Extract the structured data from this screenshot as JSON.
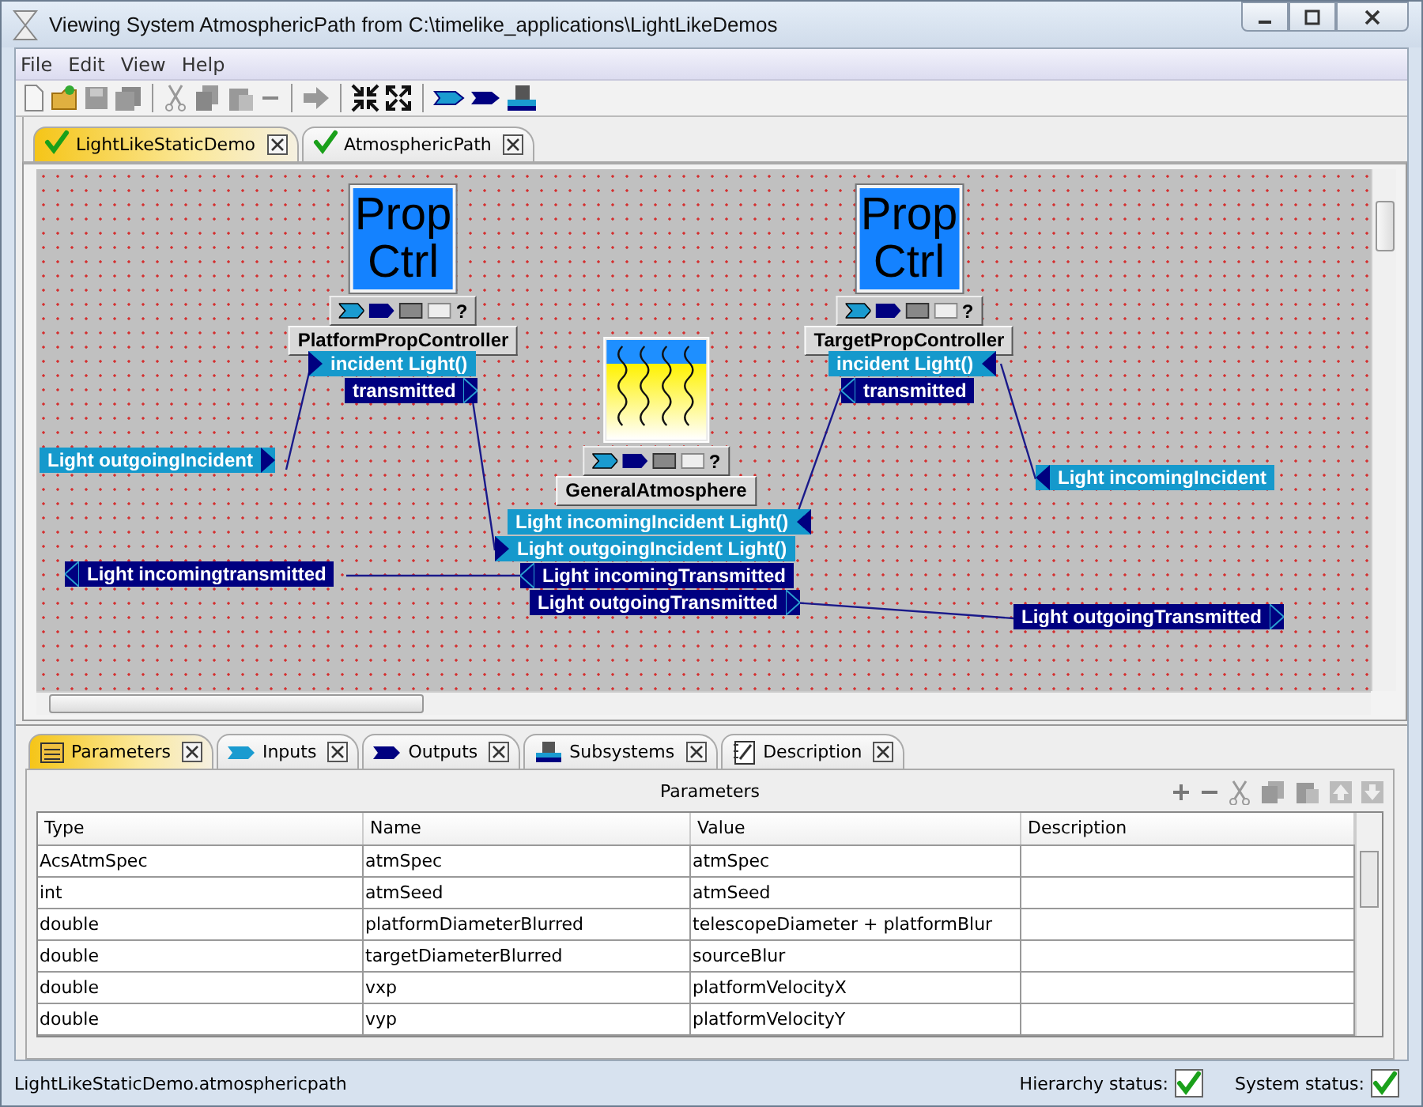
{
  "window": {
    "title": "Viewing System AtmosphericPath from C:\\timelike_applications\\LightLikeDemos"
  },
  "menu": [
    "File",
    "Edit",
    "View",
    "Help"
  ],
  "tabs": [
    {
      "label": "LightLikeStaticDemo",
      "selected": true,
      "valid": true
    },
    {
      "label": "AtmosphericPath",
      "selected": false,
      "valid": true
    }
  ],
  "diagram": {
    "nodes": [
      {
        "kind": "prop-ctrl",
        "icon_lines": [
          "Prop",
          "Ctrl"
        ],
        "help": "?",
        "name": "PlatformPropController",
        "ports": [
          {
            "label": "incident Light()",
            "kind": "input"
          },
          {
            "label": "transmitted",
            "kind": "output"
          }
        ]
      },
      {
        "kind": "prop-ctrl",
        "icon_lines": [
          "Prop",
          "Ctrl"
        ],
        "help": "?",
        "name": "TargetPropController",
        "ports": [
          {
            "label": "incident Light()",
            "kind": "input"
          },
          {
            "label": "transmitted",
            "kind": "output"
          }
        ]
      },
      {
        "kind": "atmosphere",
        "help": "?",
        "name": "GeneralAtmosphere",
        "ports": [
          {
            "label": "Light incomingIncident Light()",
            "kind": "input"
          },
          {
            "label": "Light outgoingIncident  Light()",
            "kind": "input"
          },
          {
            "label": "Light incomingTransmitted",
            "kind": "output"
          },
          {
            "label": "Light outgoingTransmitted",
            "kind": "output"
          }
        ]
      }
    ],
    "boundary_ports": [
      {
        "label": "Light outgoingIncident",
        "kind": "input"
      },
      {
        "label": "Light incomingIncident",
        "kind": "input"
      },
      {
        "label": "Light incomingtransmitted",
        "kind": "output"
      },
      {
        "label": "Light outgoingTransmitted",
        "kind": "output"
      }
    ]
  },
  "panel_tabs": [
    {
      "label": "Parameters",
      "kind": "parameters",
      "selected": true
    },
    {
      "label": "Inputs",
      "kind": "inputs",
      "selected": false
    },
    {
      "label": "Outputs",
      "kind": "outputs",
      "selected": false
    },
    {
      "label": "Subsystems",
      "kind": "subsystems",
      "selected": false
    },
    {
      "label": "Description",
      "kind": "description",
      "selected": false
    }
  ],
  "parameters": {
    "title": "Parameters",
    "columns": [
      "Type",
      "Name",
      "Value",
      "Description"
    ],
    "rows": [
      {
        "type": "AcsAtmSpec",
        "name": "atmSpec",
        "value": "atmSpec"
      },
      {
        "type": "int",
        "name": "atmSeed",
        "value": "atmSeed"
      },
      {
        "type": "double",
        "name": "platformDiameterBlurred",
        "value": "telescopeDiameter + platformBlur"
      },
      {
        "type": "double",
        "name": "targetDiameterBlurred",
        "value": "sourceBlur"
      },
      {
        "type": "double",
        "name": "vxp",
        "value": "platformVelocityX"
      },
      {
        "type": "double",
        "name": "vyp",
        "value": "platformVelocityY"
      }
    ]
  },
  "status_bar": {
    "path": "LightLikeStaticDemo.atmosphericpath",
    "hierarchy_label": "Hierarchy status:",
    "hierarchy_ok": true,
    "system_label": "System status:",
    "system_ok": true
  }
}
